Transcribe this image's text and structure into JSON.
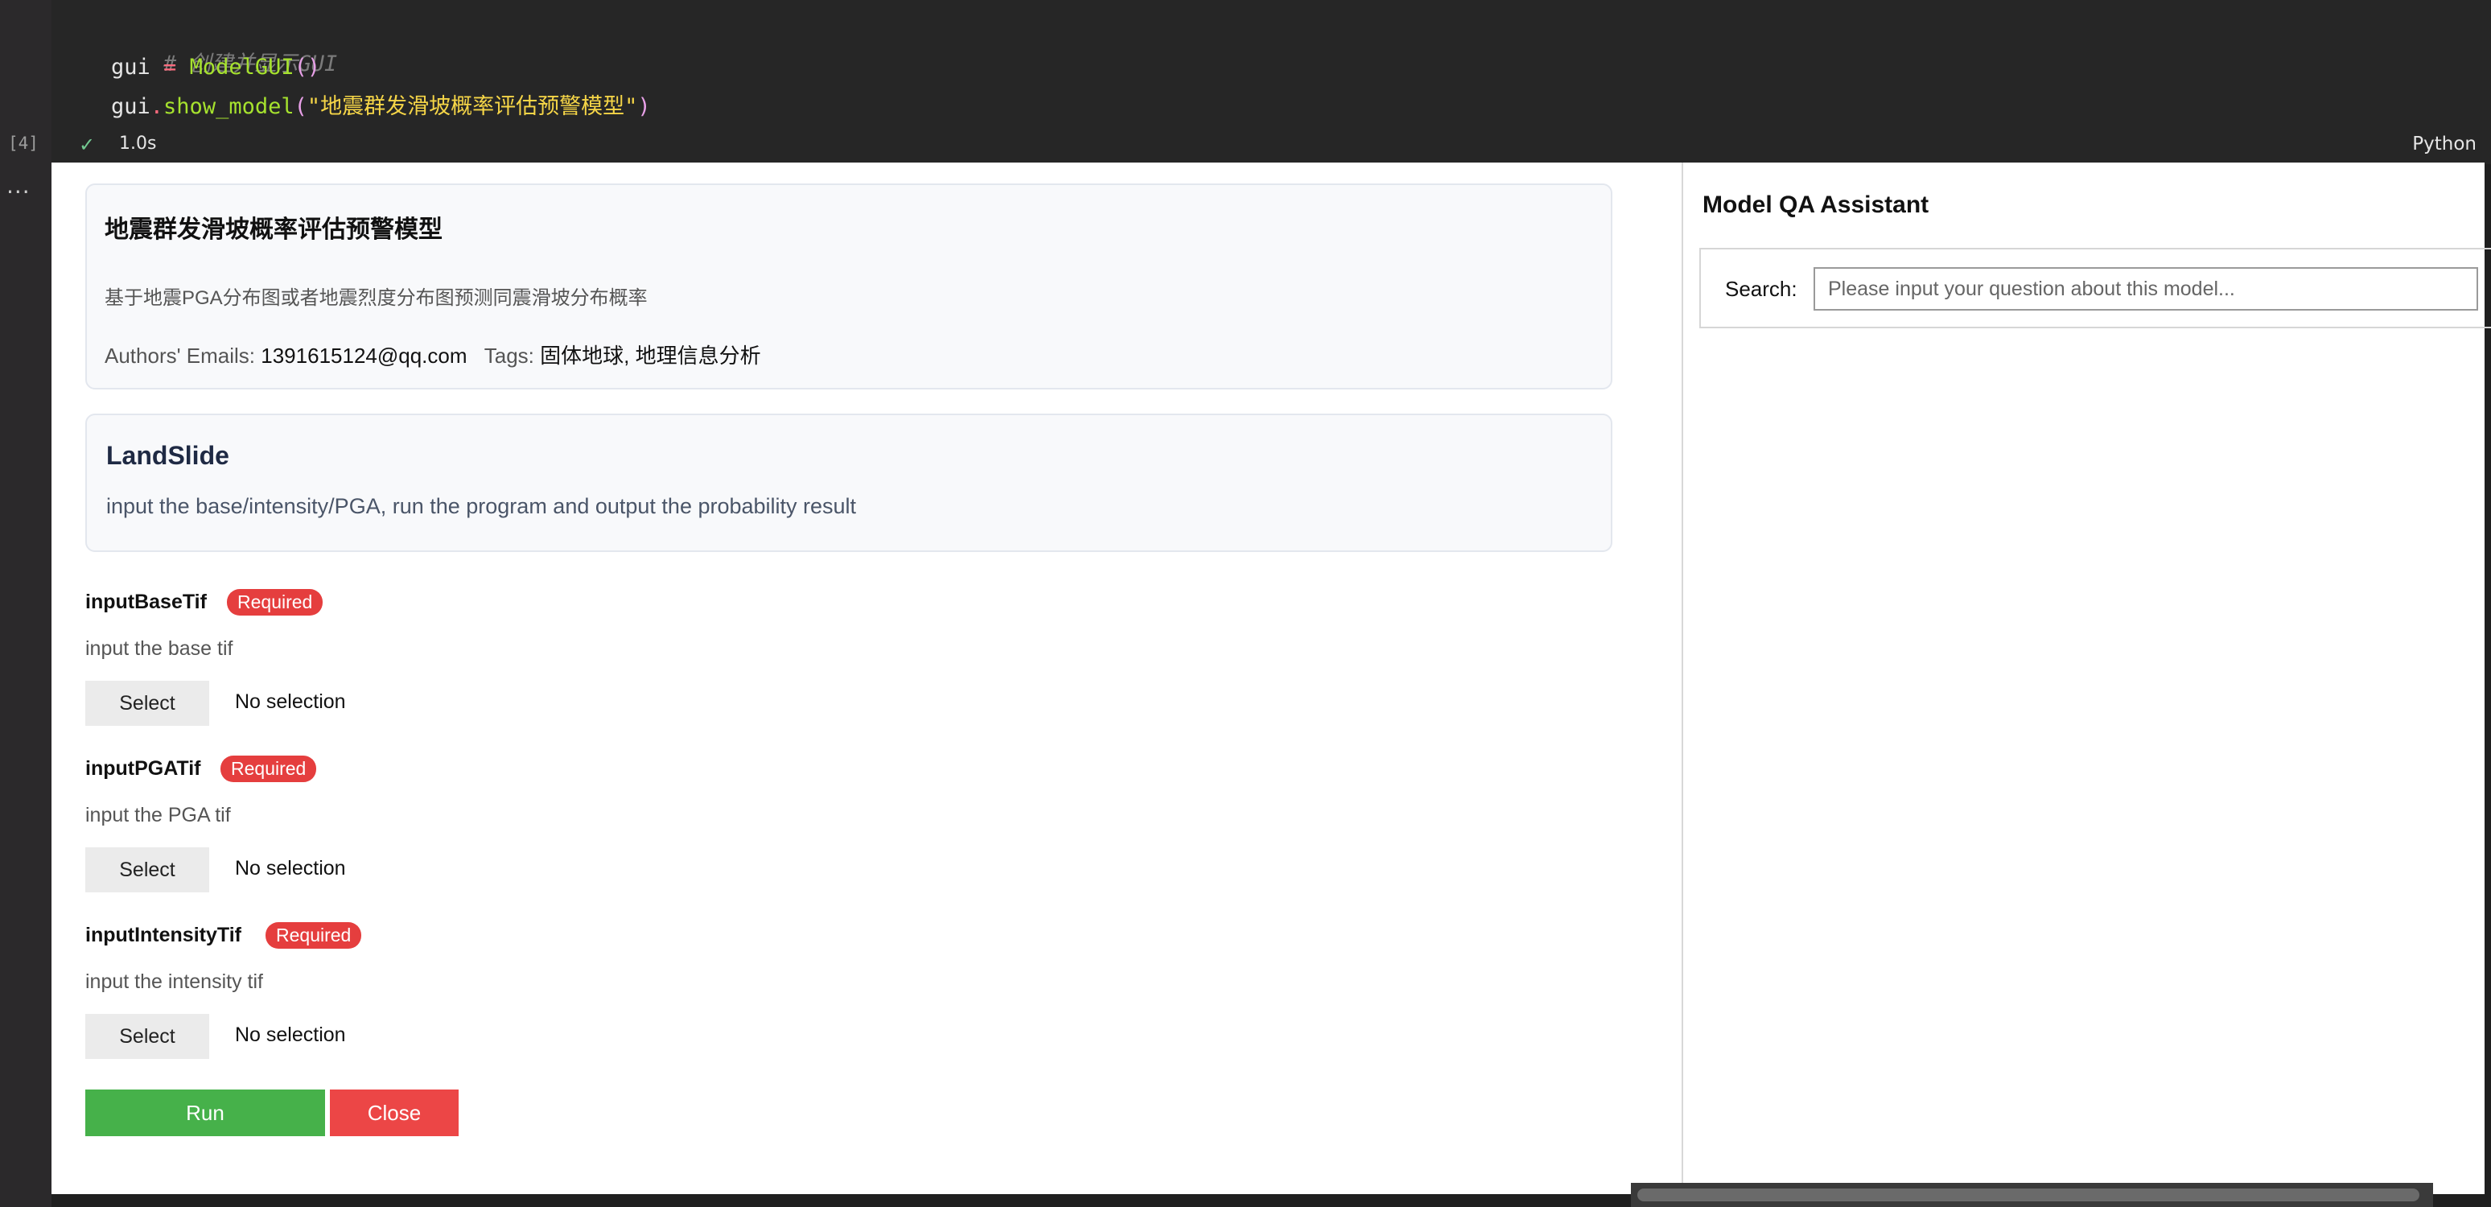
{
  "cell": {
    "execution_count": "[4]",
    "more_label": "...",
    "code": {
      "comment": "# 创建并显示GUI",
      "line2_var": "gui",
      "line2_op": " = ",
      "line2_fn": "ModelGUI",
      "line2_paren": "()",
      "line3_var": "gui",
      "line3_dot": ".",
      "line3_fn": "show_model",
      "line3_open": "(",
      "line3_str": "\"地震群发滑坡概率评估预警模型\"",
      "line3_close": ")"
    },
    "status": {
      "check": "✓",
      "time": "1.0s",
      "language": "Python"
    }
  },
  "model_info": {
    "title": "地震群发滑坡概率评估预警模型",
    "description": "基于地震PGA分布图或者地震烈度分布图预测同震滑坡分布概率",
    "authors_label": "Authors' Emails: ",
    "authors_value": "1391615124@qq.com",
    "tags_label": "Tags: ",
    "tags_value": "固体地球, 地理信息分析"
  },
  "method": {
    "name": "LandSlide",
    "description": "input the base/intensity/PGA, run the program and output the probability result"
  },
  "params": [
    {
      "name": "inputBaseTif",
      "badge": "Required",
      "description": "input the base tif",
      "button": "Select",
      "selection": "No selection"
    },
    {
      "name": "inputPGATif",
      "badge": "Required",
      "description": "input the PGA tif",
      "button": "Select",
      "selection": "No selection"
    },
    {
      "name": "inputIntensityTif",
      "badge": "Required",
      "description": "input the intensity tif",
      "button": "Select",
      "selection": "No selection"
    }
  ],
  "actions": {
    "run": "Run",
    "close": "Close"
  },
  "qa": {
    "title": "Model QA Assistant",
    "search_label": "Search:",
    "search_placeholder": "Please input your question about this model...",
    "search_value": ""
  },
  "colors": {
    "run": "#46b14a",
    "close": "#ec4646",
    "badge": "#e53e3e"
  }
}
